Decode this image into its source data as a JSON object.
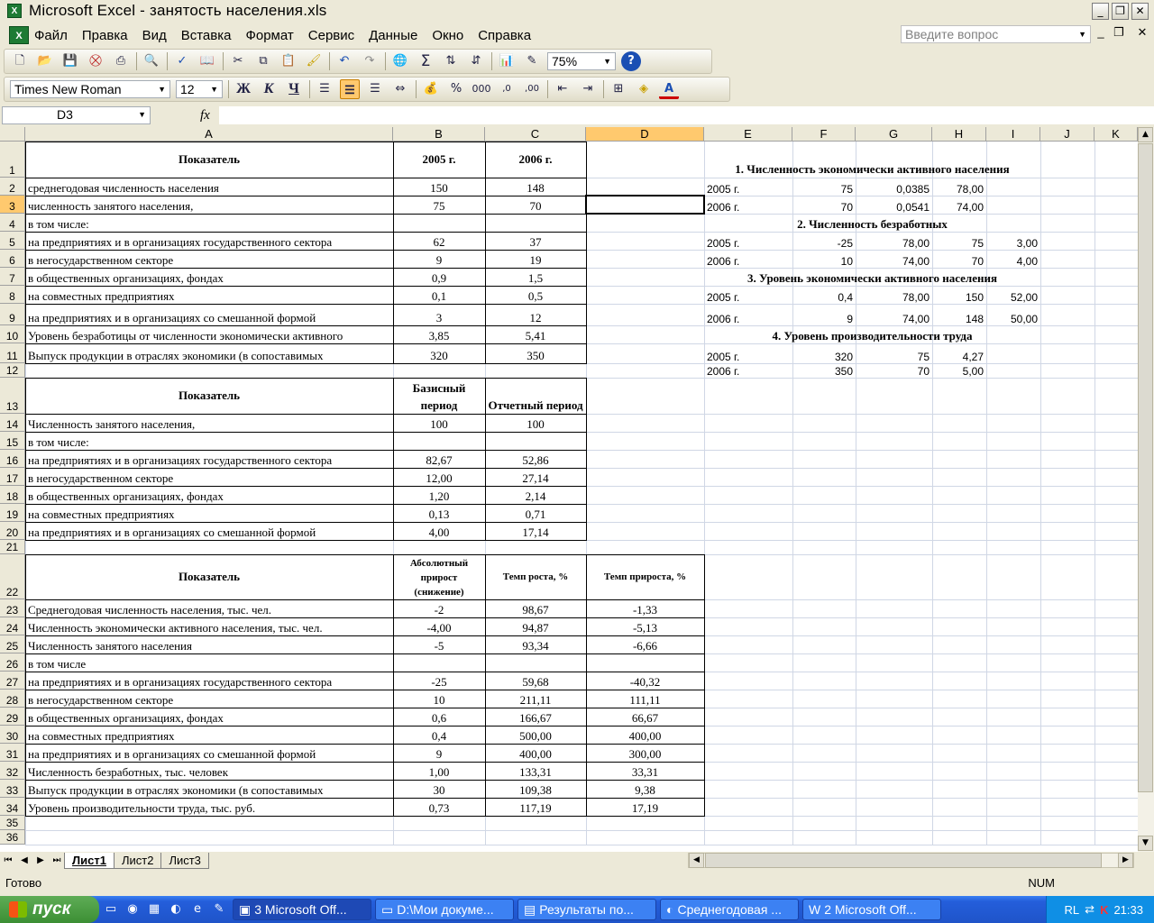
{
  "window": {
    "title": "Microsoft Excel - занятость населения.xls",
    "app_icon": "excel-icon"
  },
  "menu": {
    "items": [
      "Файл",
      "Правка",
      "Вид",
      "Вставка",
      "Формат",
      "Сервис",
      "Данные",
      "Окно",
      "Справка"
    ],
    "help_placeholder": "Введите вопрос"
  },
  "toolbar": {
    "zoom": "75%",
    "font": "Times New Roman",
    "size": "12",
    "bold": "Ж",
    "italic": "К",
    "underline": "Ч"
  },
  "formula": {
    "cell_ref": "D3",
    "fx": "fx",
    "value": ""
  },
  "sheet": {
    "columns": [
      "A",
      "B",
      "C",
      "D",
      "E",
      "F",
      "G",
      "H",
      "I",
      "J",
      "K"
    ],
    "selected_column": "D",
    "selected_row": 3,
    "rows": [
      "1",
      "2",
      "3",
      "4",
      "5",
      "6",
      "7",
      "8",
      "9",
      "10",
      "11",
      "12",
      "13",
      "14",
      "15",
      "16",
      "17",
      "18",
      "19",
      "20",
      "21",
      "22",
      "23",
      "24",
      "25",
      "26",
      "27",
      "28",
      "29",
      "30",
      "31",
      "32",
      "33",
      "34",
      "35",
      "36"
    ],
    "cells": [
      {
        "k": "A1",
        "t": "Показатель"
      },
      {
        "k": "B1",
        "t": "2005 г."
      },
      {
        "k": "C1",
        "t": "2006 г."
      },
      {
        "k": "E1",
        "t": "1. Численность экономически активного населения"
      },
      {
        "k": "A2",
        "t": "среднегодовая численность населения"
      },
      {
        "k": "B2",
        "t": "150"
      },
      {
        "k": "C2",
        "t": "148"
      },
      {
        "k": "E2",
        "t": "2005 г."
      },
      {
        "k": "F2",
        "t": "75"
      },
      {
        "k": "G2",
        "t": "0,0385"
      },
      {
        "k": "H2",
        "t": "78,00"
      },
      {
        "k": "A3",
        "t": "численность занятого населения,"
      },
      {
        "k": "B3",
        "t": "75"
      },
      {
        "k": "C3",
        "t": "70"
      },
      {
        "k": "E3",
        "t": "2006 г."
      },
      {
        "k": "F3",
        "t": "70"
      },
      {
        "k": "G3",
        "t": "0,0541"
      },
      {
        "k": "H3",
        "t": "74,00"
      },
      {
        "k": "A4",
        "t": "в том числе:"
      },
      {
        "k": "E4",
        "t": "2. Численность безработных"
      },
      {
        "k": "A5",
        "t": "на предприятиях и в организациях государственного сектора"
      },
      {
        "k": "B5",
        "t": "62"
      },
      {
        "k": "C5",
        "t": "37"
      },
      {
        "k": "E5",
        "t": "2005 г."
      },
      {
        "k": "F5",
        "t": "-25"
      },
      {
        "k": "G5",
        "t": "78,00"
      },
      {
        "k": "H5",
        "t": "75"
      },
      {
        "k": "I5",
        "t": "3,00"
      },
      {
        "k": "A6",
        "t": "в негосударственном секторе"
      },
      {
        "k": "B6",
        "t": "9"
      },
      {
        "k": "C6",
        "t": "19"
      },
      {
        "k": "E6",
        "t": "2006 г."
      },
      {
        "k": "F6",
        "t": "10"
      },
      {
        "k": "G6",
        "t": "74,00"
      },
      {
        "k": "H6",
        "t": "70"
      },
      {
        "k": "I6",
        "t": "4,00"
      },
      {
        "k": "A7",
        "t": "в общественных организациях, фондах"
      },
      {
        "k": "B7",
        "t": "0,9"
      },
      {
        "k": "C7",
        "t": "1,5"
      },
      {
        "k": "E7",
        "t": "3. Уровень экономически активного населения"
      },
      {
        "k": "A8",
        "t": "на совместных предприятиях"
      },
      {
        "k": "B8",
        "t": "0,1"
      },
      {
        "k": "C8",
        "t": "0,5"
      },
      {
        "k": "E8",
        "t": "2005 г."
      },
      {
        "k": "F8",
        "t": "0,4"
      },
      {
        "k": "G8",
        "t": "78,00"
      },
      {
        "k": "H8",
        "t": "150"
      },
      {
        "k": "I8",
        "t": "52,00"
      },
      {
        "k": "A9",
        "t": "на  предприятиях  и  в  организациях  со  смешанной  формой"
      },
      {
        "k": "B9",
        "t": "3"
      },
      {
        "k": "C9",
        "t": "12"
      },
      {
        "k": "E9",
        "t": "2006 г."
      },
      {
        "k": "F9",
        "t": "9"
      },
      {
        "k": "G9",
        "t": "74,00"
      },
      {
        "k": "H9",
        "t": "148"
      },
      {
        "k": "I9",
        "t": "50,00"
      },
      {
        "k": "A10",
        "t": "Уровень  безработицы  от  численности  экономически  активного"
      },
      {
        "k": "B10",
        "t": "3,85"
      },
      {
        "k": "C10",
        "t": "5,41"
      },
      {
        "k": "E10",
        "t": "4. Уровень производительности труда"
      },
      {
        "k": "A11",
        "t": "Выпуск  продукции  в  отраслях  экономики  (в  сопоставимых"
      },
      {
        "k": "B11",
        "t": "320"
      },
      {
        "k": "C11",
        "t": "350"
      },
      {
        "k": "E11",
        "t": "2005 г."
      },
      {
        "k": "F11",
        "t": "320"
      },
      {
        "k": "G11",
        "t": "75"
      },
      {
        "k": "H11",
        "t": "4,27"
      },
      {
        "k": "E12",
        "t": "2006 г."
      },
      {
        "k": "F12",
        "t": "350"
      },
      {
        "k": "G12",
        "t": "70"
      },
      {
        "k": "H12",
        "t": "5,00"
      },
      {
        "k": "A13",
        "t": "Показатель"
      },
      {
        "k": "B13",
        "t": "Базисный период"
      },
      {
        "k": "C13",
        "t": "Отчетный период"
      },
      {
        "k": "A14",
        "t": "Численность занятого населения,"
      },
      {
        "k": "B14",
        "t": "100"
      },
      {
        "k": "C14",
        "t": "100"
      },
      {
        "k": "A15",
        "t": "в том числе:"
      },
      {
        "k": "A16",
        "t": "на предприятиях и в организациях государственного сектора"
      },
      {
        "k": "B16",
        "t": "82,67"
      },
      {
        "k": "C16",
        "t": "52,86"
      },
      {
        "k": "A17",
        "t": "в негосударственном секторе"
      },
      {
        "k": "B17",
        "t": "12,00"
      },
      {
        "k": "C17",
        "t": "27,14"
      },
      {
        "k": "A18",
        "t": "в общественных организациях, фондах"
      },
      {
        "k": "B18",
        "t": "1,20"
      },
      {
        "k": "C18",
        "t": "2,14"
      },
      {
        "k": "A19",
        "t": "на совместных предприятиях"
      },
      {
        "k": "B19",
        "t": "0,13"
      },
      {
        "k": "C19",
        "t": "0,71"
      },
      {
        "k": "A20",
        "t": "на  предприятиях  и  в  организациях  со  смешанной  формой"
      },
      {
        "k": "B20",
        "t": "4,00"
      },
      {
        "k": "C20",
        "t": "17,14"
      },
      {
        "k": "A22",
        "t": "Показатель"
      },
      {
        "k": "B22",
        "t": "Абсолютный прирост (снижение)"
      },
      {
        "k": "C22",
        "t": "Темп роста, %"
      },
      {
        "k": "D22",
        "t": "Темп прироста, %"
      },
      {
        "k": "A23",
        "t": "Среднегодовая численность населения, тыс. чел."
      },
      {
        "k": "B23",
        "t": "-2"
      },
      {
        "k": "C23",
        "t": "98,67"
      },
      {
        "k": "D23",
        "t": "-1,33"
      },
      {
        "k": "A24",
        "t": "Численность экономически активного населения, тыс. чел."
      },
      {
        "k": "B24",
        "t": "-4,00"
      },
      {
        "k": "C24",
        "t": "94,87"
      },
      {
        "k": "D24",
        "t": "-5,13"
      },
      {
        "k": "A25",
        "t": "Численность занятого населения"
      },
      {
        "k": "B25",
        "t": "-5"
      },
      {
        "k": "C25",
        "t": "93,34"
      },
      {
        "k": "D25",
        "t": "-6,66"
      },
      {
        "k": "A26",
        "t": "в том числе"
      },
      {
        "k": "A27",
        "t": "на предприятиях и в организациях государственного сектора"
      },
      {
        "k": "B27",
        "t": "-25"
      },
      {
        "k": "C27",
        "t": "59,68"
      },
      {
        "k": "D27",
        "t": "-40,32"
      },
      {
        "k": "A28",
        "t": "в негосударственном секторе"
      },
      {
        "k": "B28",
        "t": "10"
      },
      {
        "k": "C28",
        "t": "211,11"
      },
      {
        "k": "D28",
        "t": "111,11"
      },
      {
        "k": "A29",
        "t": "в общественных организациях, фондах"
      },
      {
        "k": "B29",
        "t": "0,6"
      },
      {
        "k": "C29",
        "t": "166,67"
      },
      {
        "k": "D29",
        "t": "66,67"
      },
      {
        "k": "A30",
        "t": "на совместных предприятиях"
      },
      {
        "k": "B30",
        "t": "0,4"
      },
      {
        "k": "C30",
        "t": "500,00"
      },
      {
        "k": "D30",
        "t": "400,00"
      },
      {
        "k": "A31",
        "t": "на предприятиях и в организациях со смешанной формой"
      },
      {
        "k": "B31",
        "t": "9"
      },
      {
        "k": "C31",
        "t": "400,00"
      },
      {
        "k": "D31",
        "t": "300,00"
      },
      {
        "k": "A32",
        "t": "Численность безработных, тыс. человек"
      },
      {
        "k": "B32",
        "t": "1,00"
      },
      {
        "k": "C32",
        "t": "133,31"
      },
      {
        "k": "D32",
        "t": "33,31"
      },
      {
        "k": "A33",
        "t": "Выпуск продукции в отраслях экономики (в сопоставимых"
      },
      {
        "k": "B33",
        "t": "30"
      },
      {
        "k": "C33",
        "t": "109,38"
      },
      {
        "k": "D33",
        "t": "9,38"
      },
      {
        "k": "A34",
        "t": "Уровень производительности труда, тыс. руб."
      },
      {
        "k": "B34",
        "t": "0,73"
      },
      {
        "k": "C34",
        "t": "117,19"
      },
      {
        "k": "D34",
        "t": "17,19"
      }
    ]
  },
  "tabs": [
    "Лист1",
    "Лист2",
    "Лист3"
  ],
  "active_tab": "Лист1",
  "status": {
    "ready": "Готово",
    "num": "NUM"
  },
  "taskbar": {
    "start": "пуск",
    "tasks": [
      {
        "label": "3 Microsoft Off...",
        "icon": "excel-icon"
      },
      {
        "label": "D:\\Мои докуме...",
        "icon": "folder-icon"
      },
      {
        "label": "Результаты по...",
        "icon": "document-icon"
      },
      {
        "label": "Среднегодовая ...",
        "icon": "firefox-icon"
      },
      {
        "label": "2 Microsoft Off...",
        "icon": "word-icon"
      }
    ],
    "lang": "RL",
    "clock": "21:33"
  }
}
